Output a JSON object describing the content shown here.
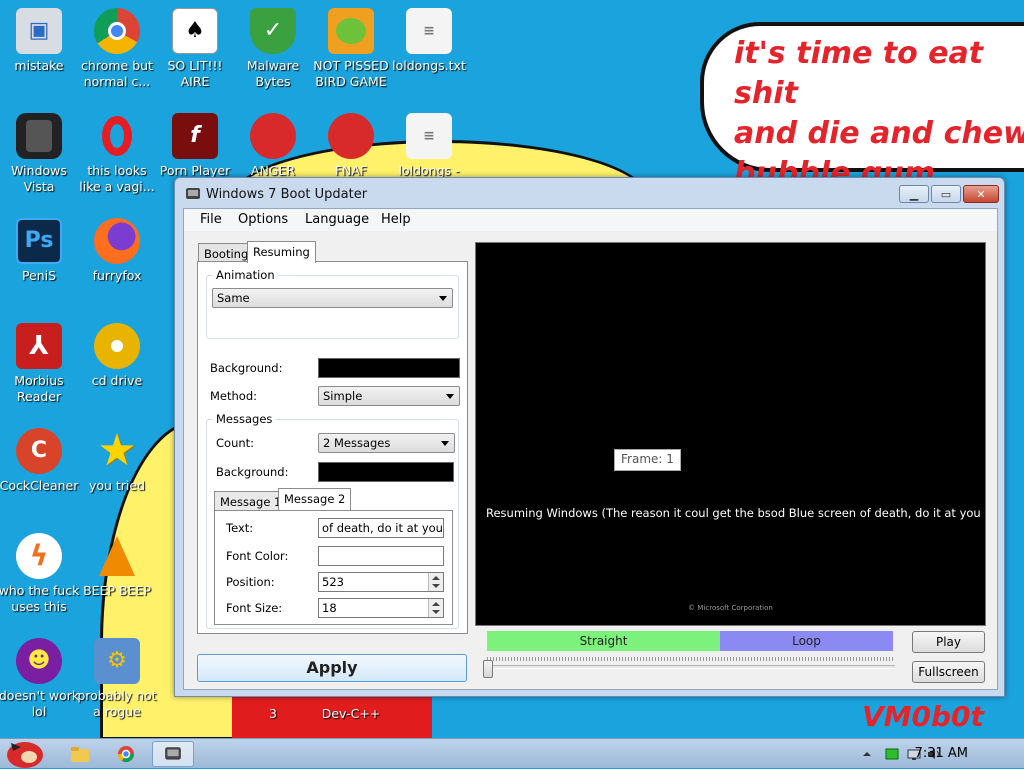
{
  "desktop": {
    "bubble_text": "it's time to eat shit\nand die and chew\nbubble gum",
    "signature": "VM0b0t",
    "icons": [
      {
        "label": "mistake"
      },
      {
        "label": "chrome but normal c..."
      },
      {
        "label": "SO LIT!!! AIRE"
      },
      {
        "label": "Malware Bytes"
      },
      {
        "label": "NOT PISSED BIRD GAME"
      },
      {
        "label": "loldongs.txt"
      },
      {
        "label": "Windows Vista"
      },
      {
        "label": "this looks like a vagi..."
      },
      {
        "label": "Porn Player"
      },
      {
        "label": "ANGER"
      },
      {
        "label": "FNAF"
      },
      {
        "label": "loldongs -"
      },
      {
        "label": "PeniS"
      },
      {
        "label": "furryfox"
      },
      {
        "label": "Morbius Reader"
      },
      {
        "label": "cd drive"
      },
      {
        "label": "CockCleaner"
      },
      {
        "label": "you tried"
      },
      {
        "label": "who the fuck uses this"
      },
      {
        "label": "BEEP BEEP"
      },
      {
        "label": "doesn't work lol"
      },
      {
        "label": "probably not a rogue"
      },
      {
        "label": "3"
      },
      {
        "label": "Dev-C++"
      }
    ]
  },
  "taskbar": {
    "clock": "7:31 AM"
  },
  "window": {
    "title": "Windows 7 Boot Updater",
    "menu": [
      "File",
      "Options",
      "Language",
      "Help"
    ],
    "tabs": [
      "Booting",
      "Resuming"
    ],
    "animation": {
      "group_title": "Animation",
      "selected": "Same"
    },
    "background_label": "Background:",
    "method_label": "Method:",
    "method_value": "Simple",
    "messages": {
      "group_title": "Messages",
      "count_label": "Count:",
      "count_value": "2 Messages",
      "background_label": "Background:",
      "tabs": [
        "Message 1",
        "Message 2"
      ],
      "text_label": "Text:",
      "text_value": "of death, do it at your ow",
      "font_color_label": "Font Color:",
      "position_label": "Position:",
      "position_value": "523",
      "font_size_label": "Font Size:",
      "font_size_value": "18"
    },
    "apply_label": "Apply",
    "preview": {
      "frame_label": "Frame: 1",
      "message": "Resuming Windows (The reason it coul get the bsod Blue screen of death, do it at your ow",
      "copyright": "© Microsoft Corporation"
    },
    "timeline": {
      "straight_label": "Straight",
      "loop_label": "Loop"
    },
    "play_label": "Play",
    "fullscreen_label": "Fullscreen"
  }
}
